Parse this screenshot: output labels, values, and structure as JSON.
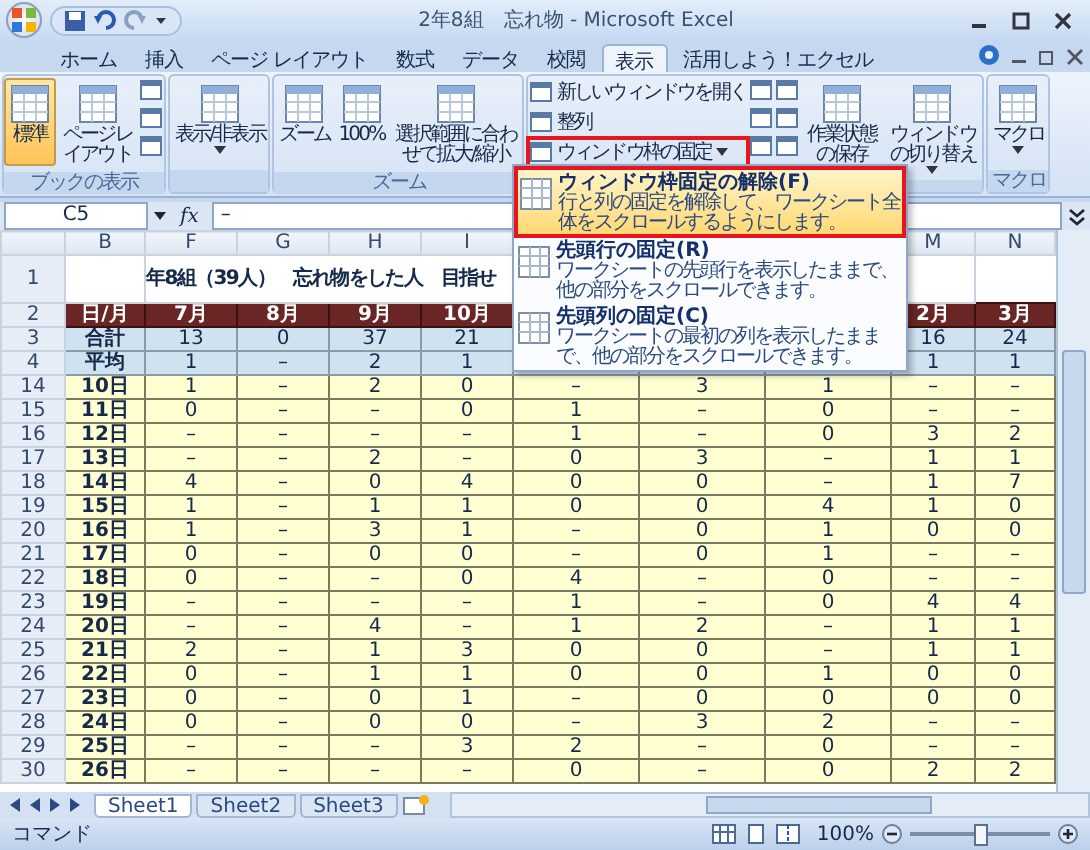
{
  "window": {
    "title": "2年8組　忘れ物 - Microsoft Excel"
  },
  "tabs": [
    {
      "label": "ホーム",
      "selected": false
    },
    {
      "label": "挿入",
      "selected": false
    },
    {
      "label": "ページ レイアウト",
      "selected": false
    },
    {
      "label": "数式",
      "selected": false
    },
    {
      "label": "データ",
      "selected": false
    },
    {
      "label": "校閲",
      "selected": false
    },
    {
      "label": "表示",
      "selected": true
    },
    {
      "label": "活用しよう！エクセル",
      "selected": false
    }
  ],
  "ribbon": [
    {
      "label": "ブックの表示",
      "items": [
        {
          "kind": "large",
          "label": "標準",
          "selected": true
        },
        {
          "kind": "large",
          "label": "ページレイアウト",
          "selected": false
        },
        {
          "kind": "icons"
        }
      ]
    },
    {
      "items": [
        {
          "kind": "large",
          "label": "表示/非表示",
          "dropdown": true
        }
      ]
    },
    {
      "label": "ズーム",
      "items": [
        {
          "kind": "large",
          "label": "ズーム"
        },
        {
          "kind": "large",
          "label": "100%"
        },
        {
          "kind": "large",
          "label": "選択範囲に合わせて拡大/縮小"
        }
      ]
    },
    {
      "items": [
        {
          "kind": "smalls",
          "buttons": [
            {
              "label": "新しいウィンドウを開く"
            },
            {
              "label": "整列"
            },
            {
              "label": "ウィンドウ枠の固定",
              "dropdown": true,
              "marked": true
            }
          ]
        },
        {
          "kind": "icons"
        },
        {
          "kind": "icons"
        },
        {
          "kind": "large",
          "label": "作業状態の保存"
        },
        {
          "kind": "large",
          "label": "ウィンドウの切り替え",
          "dropdown": true
        }
      ]
    },
    {
      "label": "マクロ",
      "items": [
        {
          "kind": "large",
          "label": "マクロ",
          "dropdown": true
        }
      ]
    }
  ],
  "formula_bar": {
    "cell": "C5",
    "fx": "fx",
    "value": "–"
  },
  "sheet": {
    "columns": [
      "B",
      "F",
      "G",
      "H",
      "I",
      null,
      null,
      null,
      "M",
      "N"
    ],
    "title_row": {
      "num": "1",
      "title": "年8組（39人）　忘れ物をした人　目指せ"
    },
    "rows": [
      {
        "num": "2",
        "kind": "header",
        "cells": [
          "日/月",
          "7月",
          "8月",
          "9月",
          "10月",
          null,
          null,
          null,
          "2月",
          "3月"
        ]
      },
      {
        "num": "3",
        "kind": "summary",
        "cells": [
          "合計",
          "13",
          "0",
          "37",
          "21",
          null,
          null,
          null,
          "16",
          "24"
        ]
      },
      {
        "num": "4",
        "kind": "summary",
        "cells": [
          "平均",
          "1",
          "–",
          "2",
          "1",
          null,
          null,
          null,
          "1",
          "1"
        ]
      },
      {
        "num": "14",
        "kind": "day",
        "cells": [
          "10日",
          "1",
          "–",
          "2",
          "0",
          "–",
          "3",
          "1",
          "–",
          "–"
        ]
      },
      {
        "num": "15",
        "kind": "day",
        "cells": [
          "11日",
          "0",
          "–",
          "–",
          "0",
          "1",
          "–",
          "0",
          "–",
          "–"
        ]
      },
      {
        "num": "16",
        "kind": "day",
        "cells": [
          "12日",
          "–",
          "–",
          "–",
          "–",
          "1",
          "–",
          "0",
          "3",
          "2"
        ]
      },
      {
        "num": "17",
        "kind": "day",
        "cells": [
          "13日",
          "–",
          "–",
          "2",
          "–",
          "0",
          "3",
          "–",
          "1",
          "1"
        ]
      },
      {
        "num": "18",
        "kind": "day",
        "cells": [
          "14日",
          "4",
          "–",
          "0",
          "4",
          "0",
          "0",
          "–",
          "1",
          "7"
        ]
      },
      {
        "num": "19",
        "kind": "day",
        "cells": [
          "15日",
          "1",
          "–",
          "1",
          "1",
          "0",
          "0",
          "4",
          "1",
          "0"
        ]
      },
      {
        "num": "20",
        "kind": "day",
        "cells": [
          "16日",
          "1",
          "–",
          "3",
          "1",
          "–",
          "0",
          "1",
          "0",
          "0"
        ]
      },
      {
        "num": "21",
        "kind": "day",
        "cells": [
          "17日",
          "0",
          "–",
          "0",
          "0",
          "–",
          "0",
          "1",
          "–",
          "–"
        ]
      },
      {
        "num": "22",
        "kind": "day",
        "cells": [
          "18日",
          "0",
          "–",
          "–",
          "0",
          "4",
          "–",
          "0",
          "–",
          "–"
        ]
      },
      {
        "num": "23",
        "kind": "day",
        "cells": [
          "19日",
          "–",
          "–",
          "–",
          "–",
          "1",
          "–",
          "0",
          "4",
          "4"
        ]
      },
      {
        "num": "24",
        "kind": "day",
        "cells": [
          "20日",
          "–",
          "–",
          "4",
          "–",
          "1",
          "2",
          "–",
          "1",
          "1"
        ]
      },
      {
        "num": "25",
        "kind": "day",
        "cells": [
          "21日",
          "2",
          "–",
          "1",
          "3",
          "0",
          "0",
          "–",
          "1",
          "1"
        ]
      },
      {
        "num": "26",
        "kind": "day",
        "cells": [
          "22日",
          "0",
          "–",
          "1",
          "1",
          "0",
          "0",
          "1",
          "0",
          "0"
        ]
      },
      {
        "num": "27",
        "kind": "day",
        "cells": [
          "23日",
          "0",
          "–",
          "0",
          "1",
          "–",
          "0",
          "0",
          "0",
          "0"
        ]
      },
      {
        "num": "28",
        "kind": "day",
        "cells": [
          "24日",
          "0",
          "–",
          "0",
          "0",
          "–",
          "3",
          "2",
          "–",
          "–"
        ]
      },
      {
        "num": "29",
        "kind": "day",
        "cells": [
          "25日",
          "–",
          "–",
          "–",
          "3",
          "2",
          "–",
          "0",
          "–",
          "–"
        ]
      },
      {
        "num": "30",
        "kind": "day",
        "cells": [
          "26日",
          "–",
          "–",
          "–",
          "–",
          "0",
          "–",
          "0",
          "2",
          "2"
        ]
      }
    ]
  },
  "freeze_menu": {
    "items": [
      {
        "title": "ウィンドウ枠固定の解除(F)",
        "description": "行と列の固定を解除して、ワークシート全体をスクロールするようにします。",
        "highlighted": true,
        "marked": true
      },
      {
        "title": "先頭行の固定(R)",
        "description": "ワークシートの先頭行を表示したままで、他の部分をスクロールできます。",
        "highlighted": false,
        "marked": false
      },
      {
        "title": "先頭列の固定(C)",
        "description": "ワークシートの最初の列を表示したままで、他の部分をスクロールできます。",
        "highlighted": false,
        "marked": false
      }
    ]
  },
  "sheet_tabs": [
    {
      "label": "Sheet1",
      "selected": true
    },
    {
      "label": "Sheet2",
      "selected": false
    },
    {
      "label": "Sheet3",
      "selected": false
    }
  ],
  "status_bar": {
    "mode": "コマンド",
    "zoom": "100%",
    "zoom_slider": {
      "level": 0.5
    }
  }
}
